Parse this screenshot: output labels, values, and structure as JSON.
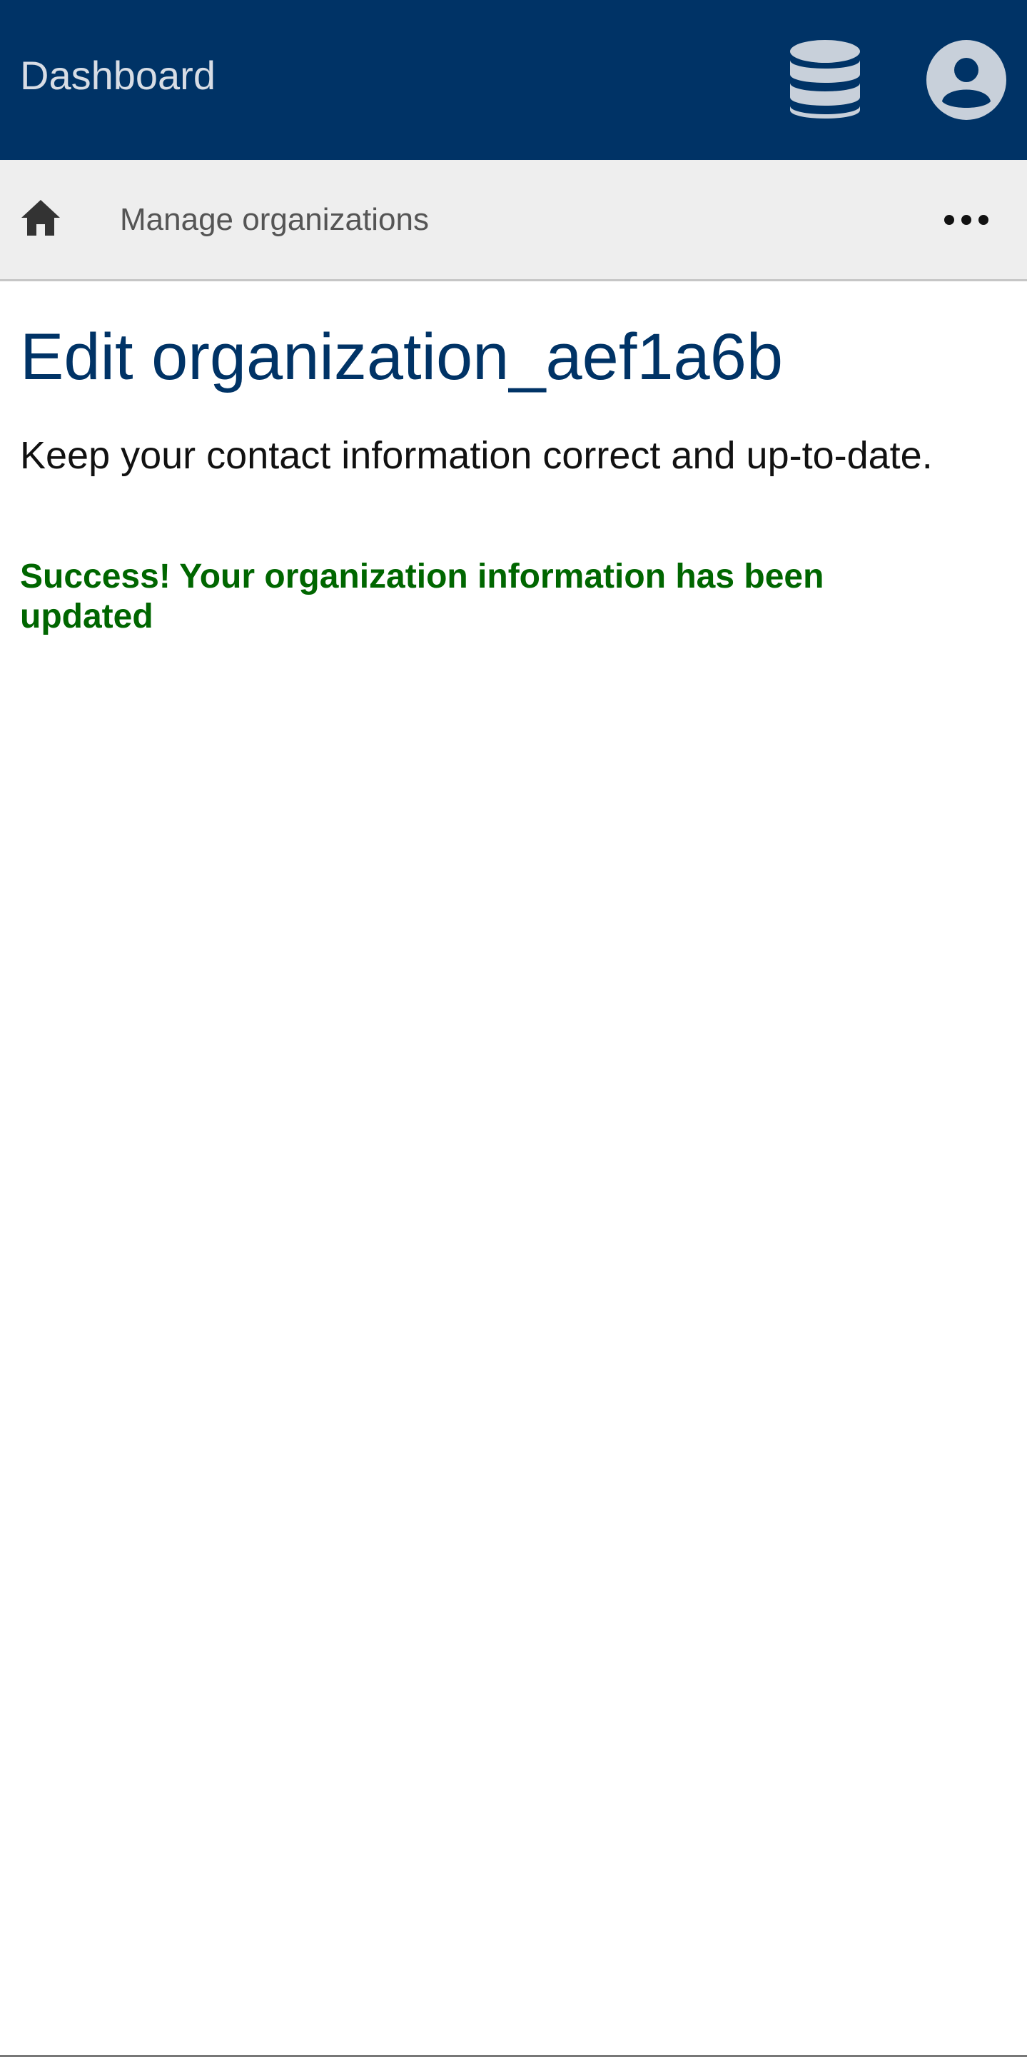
{
  "header": {
    "brand": "Dashboard",
    "background_color": "#003366",
    "icons": {
      "database": "database-icon",
      "user": "user-circle-icon"
    }
  },
  "breadcrumb": {
    "home_icon": "home-icon",
    "item": "Manage organizations",
    "more_icon": "more-horizontal-icon"
  },
  "main": {
    "title": "Edit organization_aef1a6b",
    "lead": "Keep your contact information correct and up-to-date.",
    "success_message": "Success! Your organization information has been updated",
    "success_color": "#006600",
    "title_color": "#003366"
  }
}
